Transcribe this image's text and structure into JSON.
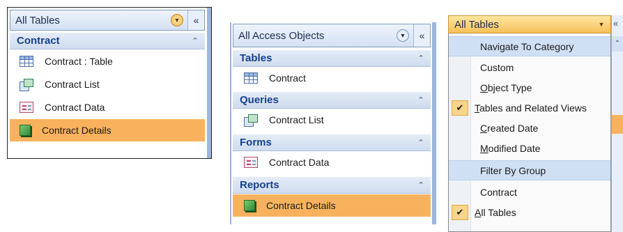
{
  "panel1": {
    "header_title": "All Tables",
    "header_collapse_glyph": "«",
    "dropdown_icon": "chevron-down-circle-icon",
    "group_title": "Contract",
    "group_collapse_glyph": "⌃",
    "items": [
      {
        "label": "Contract : Table",
        "icon": "table-icon"
      },
      {
        "label": "Contract List",
        "icon": "query-icon"
      },
      {
        "label": "Contract Data",
        "icon": "form-icon"
      },
      {
        "label": "Contract Details",
        "icon": "report-icon",
        "selected": true
      }
    ]
  },
  "panel2": {
    "header_title": "All Access Objects",
    "header_collapse_glyph": "«",
    "groups": [
      {
        "title": "Tables",
        "items": [
          {
            "label": "Contract",
            "icon": "table-icon"
          }
        ]
      },
      {
        "title": "Queries",
        "items": [
          {
            "label": "Contract List",
            "icon": "query-icon"
          }
        ]
      },
      {
        "title": "Forms",
        "items": [
          {
            "label": "Contract Data",
            "icon": "form-icon"
          }
        ]
      },
      {
        "title": "Reports",
        "items": [
          {
            "label": "Contract Details",
            "icon": "report-icon",
            "selected": true
          }
        ]
      }
    ]
  },
  "panel3": {
    "header_title": "All Tables",
    "menu": {
      "navigate_header": "Navigate To Category",
      "custom": "Custom",
      "object_type_u": "O",
      "object_type_rest": "bject Type",
      "tables_related_u": "T",
      "tables_related_rest": "ables and Related Views",
      "created_u": "C",
      "created_rest": "reated Date",
      "modified_u": "M",
      "modified_rest": "odified Date",
      "filter_header": "Filter By Group",
      "contract": "Contract",
      "all_tables_u": "A",
      "all_tables_rest": "ll Tables",
      "check_glyph": "✔"
    }
  },
  "colors": {
    "selection": "#f8b25e",
    "group_header": "#cfdcef",
    "dropdown_header": "#f5c15a",
    "menu_section_header": "#cfe0f5"
  }
}
